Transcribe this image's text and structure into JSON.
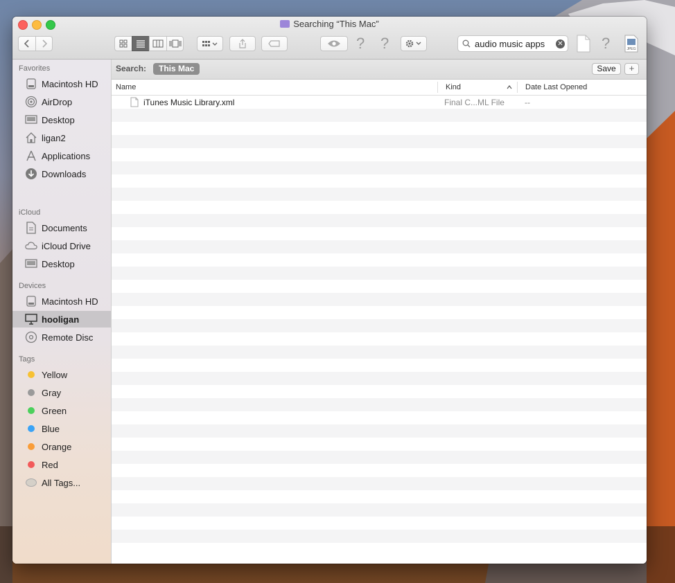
{
  "window": {
    "title": "Searching “This Mac”"
  },
  "toolbar": {
    "search_value": "audio music apps",
    "icons": [
      "back-icon",
      "forward-icon",
      "icon-view-icon",
      "list-view-icon",
      "column-view-icon",
      "cover-flow-icon",
      "arrange-icon",
      "share-icon",
      "tag-icon",
      "quicklook-icon",
      "help-icon",
      "action-gear-icon",
      "search-icon",
      "document-icon",
      "jpeg-icon"
    ]
  },
  "sidebar": {
    "favorites_header": "Favorites",
    "favorites": [
      {
        "label": "Macintosh HD",
        "icon": "disk-icon"
      },
      {
        "label": "AirDrop",
        "icon": "airdrop-icon"
      },
      {
        "label": "Desktop",
        "icon": "desktop-icon"
      },
      {
        "label": "ligan2",
        "icon": "home-icon"
      },
      {
        "label": "Applications",
        "icon": "applications-icon"
      },
      {
        "label": "Downloads",
        "icon": "downloads-icon"
      }
    ],
    "icloud_header": "iCloud",
    "icloud": [
      {
        "label": "Documents",
        "icon": "documents-icon"
      },
      {
        "label": "iCloud Drive",
        "icon": "cloud-icon"
      },
      {
        "label": "Desktop",
        "icon": "desktop-icon"
      }
    ],
    "devices_header": "Devices",
    "devices": [
      {
        "label": "Macintosh HD",
        "icon": "disk-icon"
      },
      {
        "label": "hooligan",
        "icon": "monitor-icon",
        "selected": true
      },
      {
        "label": "Remote Disc",
        "icon": "disc-icon"
      }
    ],
    "tags_header": "Tags",
    "tags": [
      {
        "label": "Yellow",
        "color": "#f7c133"
      },
      {
        "label": "Gray",
        "color": "#9a9a9a"
      },
      {
        "label": "Green",
        "color": "#4cd05c"
      },
      {
        "label": "Blue",
        "color": "#3aa3f6"
      },
      {
        "label": "Orange",
        "color": "#f99d38"
      },
      {
        "label": "Red",
        "color": "#f25a5a"
      },
      {
        "label": "All Tags...",
        "color": "#d5d0c8"
      }
    ]
  },
  "scope": {
    "label": "Search:",
    "scope": "This Mac",
    "save": "Save",
    "add": "+"
  },
  "columns": {
    "name": "Name",
    "kind": "Kind",
    "date": "Date Last Opened"
  },
  "files": [
    {
      "name": "iTunes Music Library.xml",
      "kind": "Final C...ML File",
      "date": "--"
    }
  ]
}
